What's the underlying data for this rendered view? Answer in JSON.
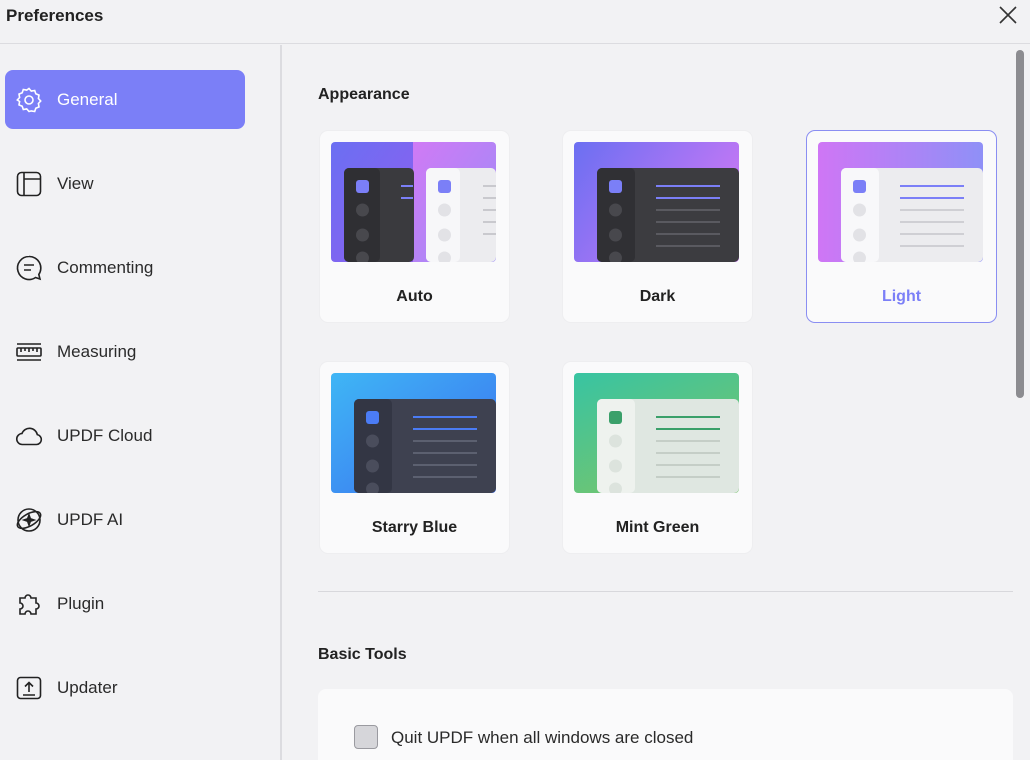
{
  "window": {
    "title": "Preferences",
    "close_icon": "close-icon"
  },
  "sidebar": {
    "items": [
      {
        "label": "General",
        "icon": "gear-icon",
        "active": true
      },
      {
        "label": "View",
        "icon": "layout-icon"
      },
      {
        "label": "Commenting",
        "icon": "comment-icon"
      },
      {
        "label": "Measuring",
        "icon": "ruler-icon"
      },
      {
        "label": "UPDF Cloud",
        "icon": "cloud-icon"
      },
      {
        "label": "UPDF AI",
        "icon": "ai-icon"
      },
      {
        "label": "Plugin",
        "icon": "puzzle-icon"
      },
      {
        "label": "Updater",
        "icon": "update-icon"
      }
    ]
  },
  "appearance": {
    "title": "Appearance",
    "themes": [
      {
        "label": "Auto"
      },
      {
        "label": "Dark"
      },
      {
        "label": "Light",
        "selected": true
      },
      {
        "label": "Starry Blue"
      },
      {
        "label": "Mint Green"
      }
    ]
  },
  "basic_tools": {
    "title": "Basic Tools",
    "quit_option": {
      "label": "Quit UPDF when all windows are closed",
      "checked": false
    }
  },
  "colors": {
    "accent": "#7b7ff7",
    "background": "#f2f2f4",
    "card": "#fafafb"
  }
}
